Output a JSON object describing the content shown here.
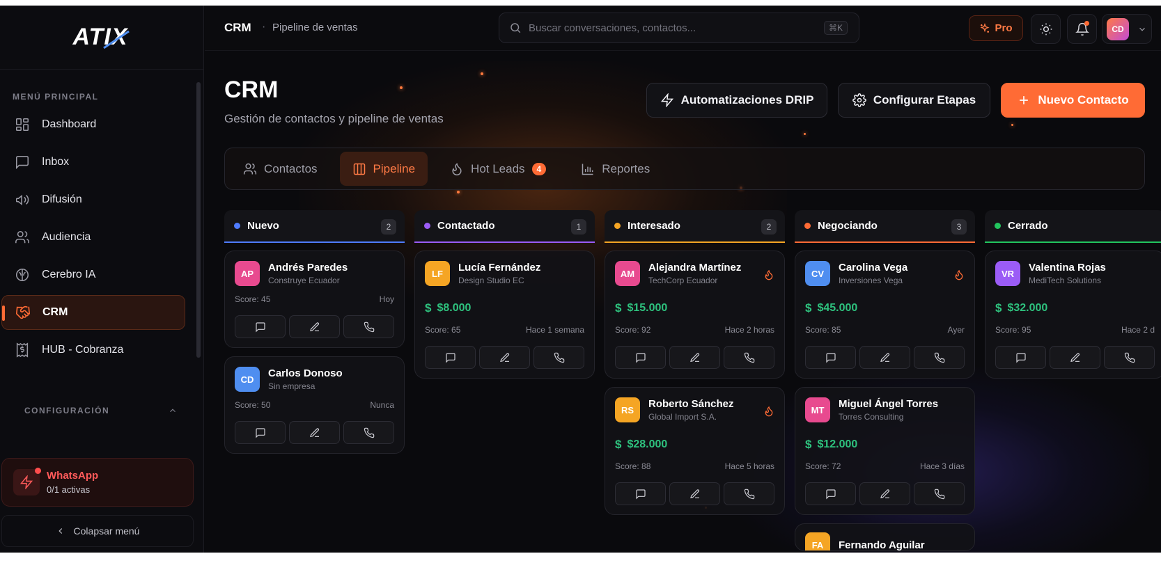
{
  "logo": "ATIX",
  "sidebar": {
    "section_title": "MENÚ PRINCIPAL",
    "items": [
      {
        "label": "Dashboard"
      },
      {
        "label": "Inbox"
      },
      {
        "label": "Difusión"
      },
      {
        "label": "Audiencia"
      },
      {
        "label": "Cerebro IA"
      },
      {
        "label": "CRM"
      },
      {
        "label": "HUB - Cobranza"
      }
    ],
    "config_title": "CONFIGURACIÓN",
    "whatsapp": {
      "title": "WhatsApp",
      "status": "0/1 activas"
    },
    "collapse_label": "Colapsar menú"
  },
  "topbar": {
    "breadcrumb_main": "CRM",
    "breadcrumb_sep": "·",
    "breadcrumb_sub": "Pipeline de ventas",
    "search_placeholder": "Buscar conversaciones, contactos...",
    "search_shortcut": "⌘K",
    "pro_label": "Pro",
    "user_initials": "CD"
  },
  "page": {
    "title": "CRM",
    "subtitle": "Gestión de contactos y pipeline de ventas",
    "btn_drip": "Automatizaciones DRIP",
    "btn_stages": "Configurar Etapas",
    "btn_new": "Nuevo Contacto"
  },
  "tabs": [
    {
      "label": "Contactos"
    },
    {
      "label": "Pipeline"
    },
    {
      "label": "Hot Leads",
      "badge": "4"
    },
    {
      "label": "Reportes"
    }
  ],
  "colors": {
    "accent": "#ff6b35",
    "money": "#2ec27e"
  },
  "columns": [
    {
      "name": "Nuevo",
      "count": "2",
      "color": "#4f7cff",
      "cards": [
        {
          "initials": "AP",
          "name": "Andrés Paredes",
          "company": "Construye Ecuador",
          "score": "Score: 45",
          "when": "Hoy",
          "color": "#e84a8f",
          "amount": null,
          "hot": false
        },
        {
          "initials": "CD",
          "name": "Carlos Donoso",
          "company": "Sin empresa",
          "score": "Score: 50",
          "when": "Nunca",
          "color": "#4f8ef0",
          "amount": null,
          "hot": false
        }
      ]
    },
    {
      "name": "Contactado",
      "count": "1",
      "color": "#9b5cf6",
      "cards": [
        {
          "initials": "LF",
          "name": "Lucía Fernández",
          "company": "Design Studio EC",
          "score": "Score: 65",
          "when": "Hace 1 semana",
          "color": "#f5a524",
          "amount": "$8.000",
          "hot": false
        }
      ]
    },
    {
      "name": "Interesado",
      "count": "2",
      "color": "#f5a524",
      "cards": [
        {
          "initials": "AM",
          "name": "Alejandra Martínez",
          "company": "TechCorp Ecuador",
          "score": "Score: 92",
          "when": "Hace 2 horas",
          "color": "#e84a8f",
          "amount": "$15.000",
          "hot": true
        },
        {
          "initials": "RS",
          "name": "Roberto Sánchez",
          "company": "Global Import S.A.",
          "score": "Score: 88",
          "when": "Hace 5 horas",
          "color": "#f5a524",
          "amount": "$28.000",
          "hot": true
        }
      ]
    },
    {
      "name": "Negociando",
      "count": "3",
      "color": "#ff6b35",
      "cards": [
        {
          "initials": "CV",
          "name": "Carolina Vega",
          "company": "Inversiones Vega",
          "score": "Score: 85",
          "when": "Ayer",
          "color": "#4f8ef0",
          "amount": "$45.000",
          "hot": true
        },
        {
          "initials": "MT",
          "name": "Miguel Ángel Torres",
          "company": "Torres Consulting",
          "score": "Score: 72",
          "when": "Hace 3 días",
          "color": "#e84a8f",
          "amount": "$12.000",
          "hot": false
        },
        {
          "initials": "FA",
          "name": "Fernando Aguilar",
          "company": "",
          "score": "",
          "when": "",
          "color": "#f5a524",
          "amount": null,
          "hot": false
        }
      ]
    },
    {
      "name": "Cerrado",
      "count": "",
      "color": "#22c55e",
      "cards": [
        {
          "initials": "VR",
          "name": "Valentina Rojas",
          "company": "MediTech Solutions",
          "score": "Score: 95",
          "when": "Hace 2 d",
          "color": "#9b5cf6",
          "amount": "$32.000",
          "hot": false
        }
      ]
    }
  ]
}
